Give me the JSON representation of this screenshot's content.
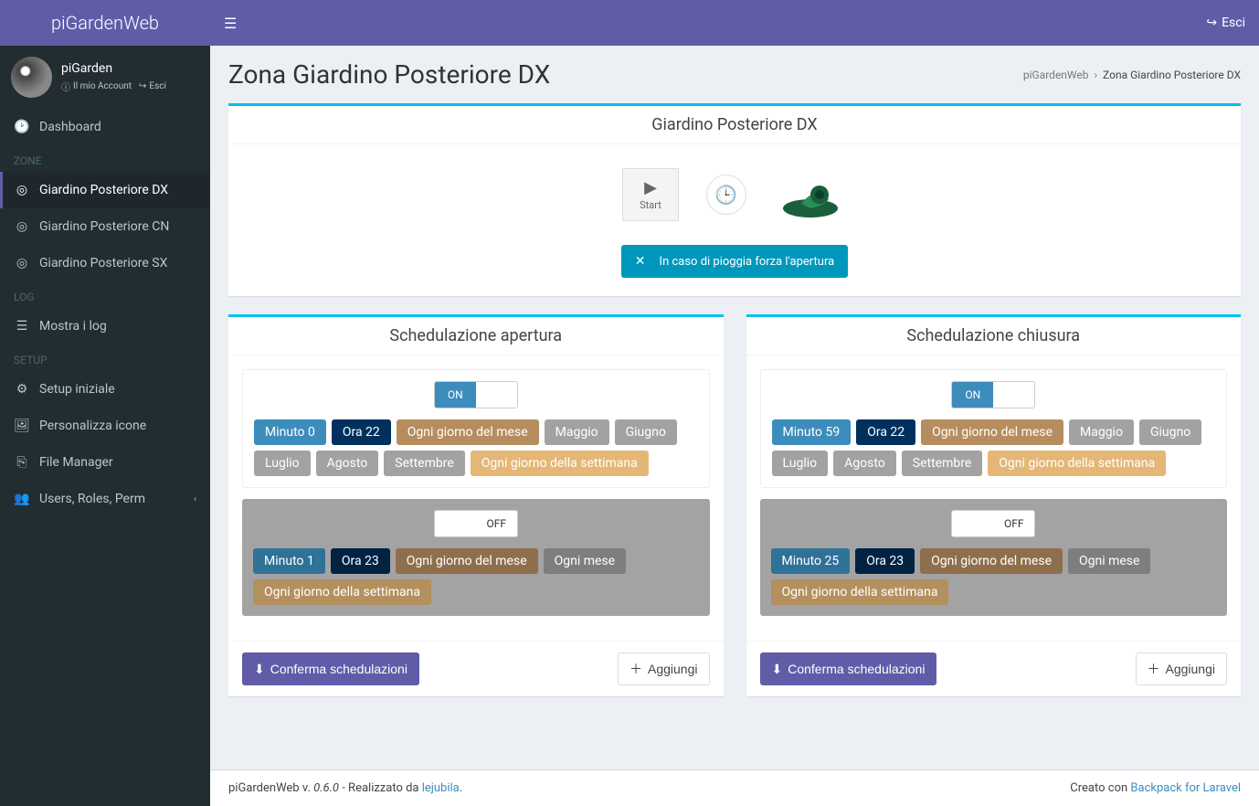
{
  "app": {
    "name": "piGardenWeb",
    "version": "0.6.0"
  },
  "user": {
    "name": "piGarden",
    "account_label": "Il mio Account",
    "exit_label": "Esci"
  },
  "navbar": {
    "exit_label": "Esci"
  },
  "sidebar": {
    "dashboard": "Dashboard",
    "section_zone": "ZONE",
    "zones": [
      {
        "label": "Giardino Posteriore DX"
      },
      {
        "label": "Giardino Posteriore CN"
      },
      {
        "label": "Giardino Posteriore SX"
      }
    ],
    "section_log": "LOG",
    "log_item": "Mostra i log",
    "section_setup": "SETUP",
    "setup_items": [
      {
        "label": "Setup iniziale"
      },
      {
        "label": "Personalizza icone"
      },
      {
        "label": "File Manager"
      },
      {
        "label": "Users, Roles, Perm"
      }
    ]
  },
  "breadcrumb": {
    "root": "piGardenWeb",
    "current": "Zona Giardino Posteriore DX"
  },
  "page": {
    "title": "Zona Giardino Posteriore DX"
  },
  "zone_box": {
    "title": "Giardino Posteriore DX",
    "start_label": "Start",
    "rain_text": "In caso di pioggia forza l'apertura"
  },
  "schedule_open": {
    "title": "Schedulazione apertura",
    "toggle_on": "ON",
    "toggle_off": "OFF",
    "entries": [
      {
        "state": "on",
        "badges": [
          {
            "text": "Minuto 0",
            "cls": "b-minute"
          },
          {
            "text": "Ora 22",
            "cls": "b-hour"
          },
          {
            "text": "Ogni giorno del mese",
            "cls": "b-monthday"
          },
          {
            "text": "Maggio",
            "cls": "b-month"
          },
          {
            "text": "Giugno",
            "cls": "b-month"
          },
          {
            "text": "Luglio",
            "cls": "b-month"
          },
          {
            "text": "Agosto",
            "cls": "b-month"
          },
          {
            "text": "Settembre",
            "cls": "b-month"
          },
          {
            "text": "Ogni giorno della settimana",
            "cls": "b-weekday"
          }
        ]
      },
      {
        "state": "off",
        "badges": [
          {
            "text": "Minuto 1",
            "cls": "b-minute"
          },
          {
            "text": "Ora 23",
            "cls": "b-hour"
          },
          {
            "text": "Ogni giorno del mese",
            "cls": "b-monthday"
          },
          {
            "text": "Ogni mese",
            "cls": "b-month"
          },
          {
            "text": "Ogni giorno della settimana",
            "cls": "b-weekday"
          }
        ]
      }
    ],
    "confirm_label": "Conferma schedulazioni",
    "add_label": "Aggiungi"
  },
  "schedule_close": {
    "title": "Schedulazione chiusura",
    "toggle_on": "ON",
    "toggle_off": "OFF",
    "entries": [
      {
        "state": "on",
        "badges": [
          {
            "text": "Minuto 59",
            "cls": "b-minute"
          },
          {
            "text": "Ora 22",
            "cls": "b-hour"
          },
          {
            "text": "Ogni giorno del mese",
            "cls": "b-monthday"
          },
          {
            "text": "Maggio",
            "cls": "b-month"
          },
          {
            "text": "Giugno",
            "cls": "b-month"
          },
          {
            "text": "Luglio",
            "cls": "b-month"
          },
          {
            "text": "Agosto",
            "cls": "b-month"
          },
          {
            "text": "Settembre",
            "cls": "b-month"
          },
          {
            "text": "Ogni giorno della settimana",
            "cls": "b-weekday"
          }
        ]
      },
      {
        "state": "off",
        "badges": [
          {
            "text": "Minuto 25",
            "cls": "b-minute"
          },
          {
            "text": "Ora 23",
            "cls": "b-hour"
          },
          {
            "text": "Ogni giorno del mese",
            "cls": "b-monthday"
          },
          {
            "text": "Ogni mese",
            "cls": "b-month"
          },
          {
            "text": "Ogni giorno della settimana",
            "cls": "b-weekday"
          }
        ]
      }
    ],
    "confirm_label": "Conferma schedulazioni",
    "add_label": "Aggiungi"
  },
  "footer": {
    "left_pre": "piGardenWeb v. ",
    "left_post": " - Realizzato da ",
    "author": "lejubila",
    "right_pre": "Creato con ",
    "right_link": "Backpack for Laravel"
  }
}
